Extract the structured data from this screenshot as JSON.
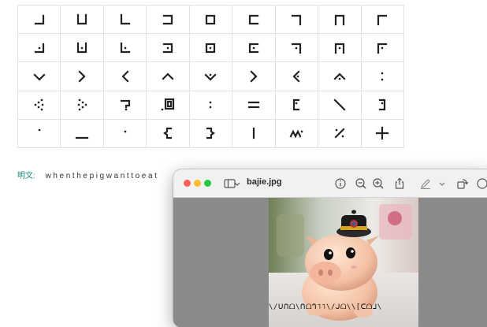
{
  "glyph_grid": {
    "rows": [
      [
        "corner-br",
        "cup",
        "corner-bl",
        "bracket-right",
        "square",
        "bracket-left",
        "corner-tr",
        "arch",
        "corner-tl"
      ],
      [
        "corner-br-dot",
        "cup-dot",
        "corner-bl-dot",
        "bracket-right-dot",
        "square-dot",
        "bracket-left-dot",
        "corner-tr-dot",
        "arch-dot",
        "corner-tl-dot"
      ],
      [
        "chevron-down",
        "chevron-right",
        "chevron-left",
        "chevron-up",
        "chevron-down-dot",
        "chevron-right-dot",
        "chevron-left-dot",
        "chevron-up-dot",
        "colon"
      ],
      [
        "dots-left",
        "dots-right",
        "question-box",
        "square-box-dot",
        "colon-small",
        "equals",
        "bracket-open",
        "backslash",
        "bracket-close"
      ],
      [
        "dot-top",
        "underscore",
        "dot-mid",
        "brace-open",
        "brace-close",
        "bar",
        "tilde-wave",
        "percent-slash",
        "plus"
      ]
    ]
  },
  "plaintext": {
    "label": "明文:",
    "value": "whenthepigwanttoeat"
  },
  "preview_window": {
    "title": "bajie.jpg",
    "colors": {
      "close": "#fe5f57",
      "minimize": "#febc2e",
      "zoom": "#28c840"
    },
    "toolbar_icons": [
      "sidebar-icon",
      "chevron-down-icon",
      "info-icon",
      "zoom-out-icon",
      "zoom-in-icon",
      "share-icon",
      "markup-pen-icon",
      "chevron-down-icon",
      "rotate-icon",
      "search-icon"
    ]
  },
  "cipher_caption": "\\/ᑌᑎᗝ\\ᑎᗝᒉ˥˥\\/ᒍᗝ\\\\[ᑕᗝᒧ\\"
}
